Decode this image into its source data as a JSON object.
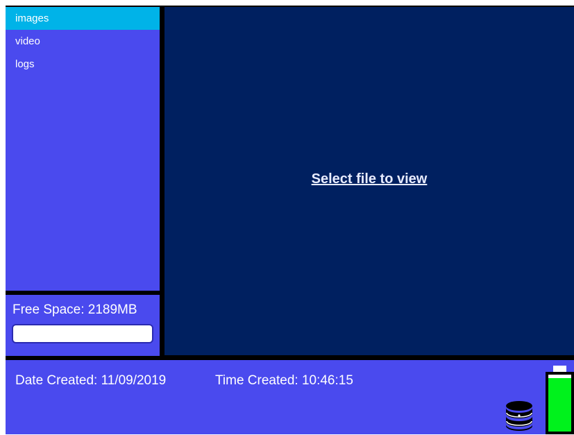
{
  "sidebar": {
    "items": [
      {
        "label": "images",
        "selected": true
      },
      {
        "label": "video",
        "selected": false
      },
      {
        "label": "logs",
        "selected": false
      }
    ]
  },
  "storage": {
    "label": "Free Space: 2189MB",
    "bar_fill_fraction": 1.0
  },
  "viewer": {
    "prompt": "Select file to view"
  },
  "status": {
    "date_label": "Date Created: 11/09/2019",
    "time_label": "Time Created: 10:46:15"
  },
  "icons": {
    "database": "database-icon",
    "battery": "battery-icon"
  },
  "battery": {
    "level_fraction": 0.9
  },
  "colors": {
    "panel_blue": "#4a4aee",
    "selected_cyan": "#00b3e8",
    "viewer_navy": "#002060",
    "battery_green": "#00f21c"
  }
}
